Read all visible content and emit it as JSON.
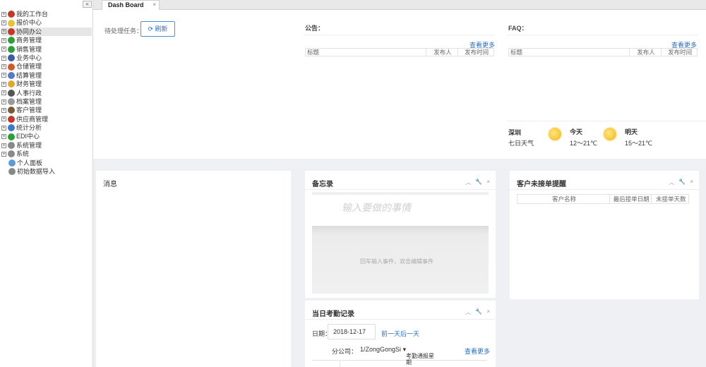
{
  "sidebar": {
    "collapse_label": "«",
    "items": [
      {
        "label": "我的工作台",
        "icon": "user-icon",
        "color": "#c0392b"
      },
      {
        "label": "报价中心",
        "icon": "bulb-icon",
        "color": "#e8c23a"
      },
      {
        "label": "协同办公",
        "icon": "people-icon",
        "color": "#c0392b",
        "active": true
      },
      {
        "label": "商务管理",
        "icon": "globe-icon",
        "color": "#2e9e3a"
      },
      {
        "label": "销售管理",
        "icon": "globe-icon",
        "color": "#2e9e3a"
      },
      {
        "label": "业务中心",
        "icon": "truck-icon",
        "color": "#3b5aa8"
      },
      {
        "label": "仓储管理",
        "icon": "grid-icon",
        "color": "#d05a2a"
      },
      {
        "label": "结算管理",
        "icon": "people-icon",
        "color": "#5a78c8"
      },
      {
        "label": "财务管理",
        "icon": "coin-icon",
        "color": "#e0a830"
      },
      {
        "label": "人事行政",
        "icon": "person-icon",
        "color": "#555555"
      },
      {
        "label": "档案管理",
        "icon": "folder-icon",
        "color": "#9a9a9a"
      },
      {
        "label": "客户管理",
        "icon": "person-icon",
        "color": "#7a5a3a"
      },
      {
        "label": "供应商管理",
        "icon": "people-icon",
        "color": "#c0392b"
      },
      {
        "label": "统计分析",
        "icon": "globe-icon",
        "color": "#3b7ac8"
      },
      {
        "label": "EDI中心",
        "icon": "play-icon",
        "color": "#2e9e3a"
      },
      {
        "label": "系统管理",
        "icon": "gear-icon",
        "color": "#8a8a8a"
      },
      {
        "label": "系统",
        "icon": "gear-icon",
        "color": "#8a8a8a"
      },
      {
        "label": "个人面板",
        "icon": "person-icon",
        "color": "#5a9ad8",
        "sub": true
      },
      {
        "label": "初始数据导入",
        "icon": "import-icon",
        "color": "#888888",
        "sub": true
      }
    ]
  },
  "tabs": [
    {
      "label": "Dash Board",
      "close": "×"
    }
  ],
  "tasks": {
    "label": "待处理任务：",
    "refresh_label": "刷新"
  },
  "notice": {
    "title": "公告：",
    "more": "查看更多",
    "columns": [
      "标题",
      "发布人",
      "发布时间"
    ]
  },
  "faq": {
    "title": "FAQ：",
    "more": "查看更多",
    "columns": [
      "标题",
      "发布人",
      "发布时间"
    ]
  },
  "weather": {
    "city": "深圳",
    "week_label": "七日天气",
    "today_label": "今天",
    "today_range": "12～21℃",
    "tomorrow_label": "明天",
    "tomorrow_range": "15～21℃"
  },
  "messages": {
    "title": "消息"
  },
  "memo": {
    "title": "备忘录",
    "placeholder": "输入要做的事情",
    "hint": "回车输入事件，双击编辑事件"
  },
  "customer_alert": {
    "title": "客户未接单提醒",
    "columns": [
      "客户名称",
      "最后接单日期",
      "未接单天数"
    ]
  },
  "attendance": {
    "title": "当日考勤记录",
    "date_label": "日期：",
    "date_value": "2018-12-17",
    "nav": "前一天后一天",
    "company_label": "分公司：",
    "company_value": "1/ZongGongSi",
    "more": "查看更多",
    "col_header": "考勤通报星期"
  },
  "controls": {
    "up": "︿",
    "wrench": "🔧",
    "close": "×"
  }
}
